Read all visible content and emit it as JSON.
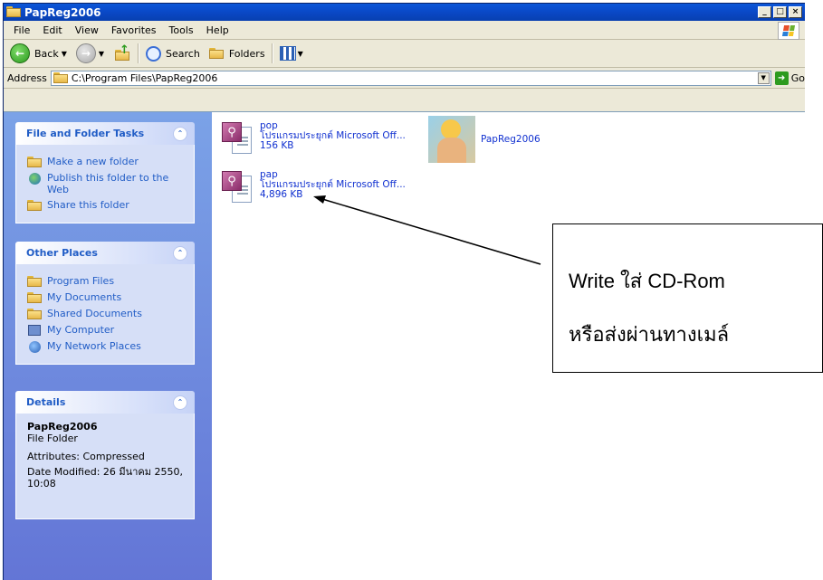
{
  "window": {
    "title": "PapReg2006",
    "controls": [
      "_",
      "□",
      "×"
    ]
  },
  "menu": [
    "File",
    "Edit",
    "View",
    "Favorites",
    "Tools",
    "Help"
  ],
  "toolbar": {
    "back_label": "Back",
    "search_label": "Search",
    "folders_label": "Folders"
  },
  "address": {
    "label": "Address",
    "value": "C:\\Program Files\\PapReg2006",
    "go_label": "Go"
  },
  "taskpane": {
    "file_tasks": {
      "title": "File and Folder Tasks",
      "items": [
        "Make a new folder",
        "Publish this folder to the Web",
        "Share this folder"
      ]
    },
    "other_places": {
      "title": "Other Places",
      "items": [
        "Program Files",
        "My Documents",
        "Shared Documents",
        "My Computer",
        "My Network Places"
      ]
    },
    "details": {
      "title": "Details",
      "name": "PapReg2006",
      "type": "File Folder",
      "attributes": "Attributes: Compressed",
      "modified": "Date Modified: 26 มีนาคม 2550, 10:08"
    }
  },
  "files": [
    {
      "name": "pop",
      "type": "โปรแกรมประยุกต์ Microsoft Off...",
      "size": "156 KB",
      "icon": "access-app-icon"
    },
    {
      "name": "PapReg2006",
      "type": "",
      "size": "",
      "icon": "image-thumbnail-icon"
    },
    {
      "name": "pap",
      "type": "โปรแกรมประยุกต์ Microsoft Off...",
      "size": "4,896 KB",
      "icon": "access-app-icon"
    }
  ],
  "callout": {
    "line1": "Write ใส่ CD-Rom",
    "line2": "หรือส่งผ่านทางเมล์"
  }
}
